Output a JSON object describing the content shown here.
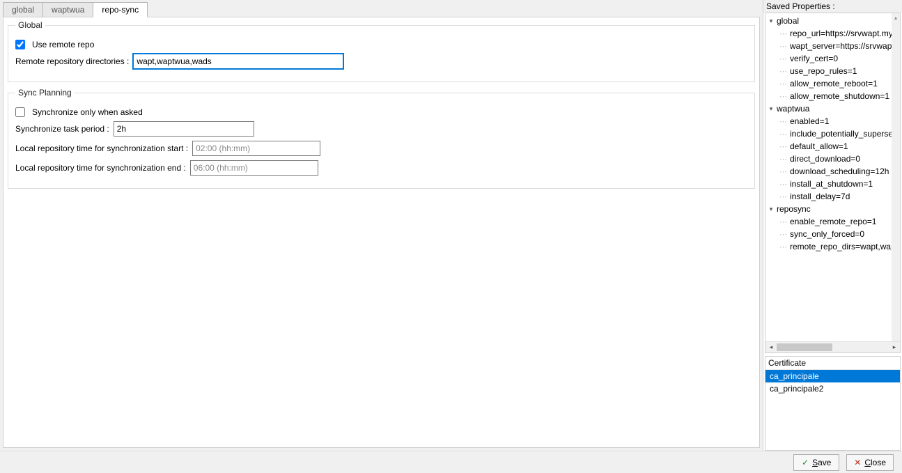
{
  "tabs": {
    "global": "global",
    "waptwua": "waptwua",
    "reposync": "repo-sync",
    "active": "reposync"
  },
  "global_group": {
    "legend": "Global",
    "use_remote_repo_label": "Use remote repo",
    "use_remote_repo_checked": true,
    "remote_dirs_label": "Remote repository directories :",
    "remote_dirs_value": "wapt,waptwua,wads"
  },
  "sync_group": {
    "legend": "Sync Planning",
    "sync_only_label": "Synchronize only when asked",
    "sync_only_checked": false,
    "period_label": "Synchronize task period :",
    "period_value": "2h",
    "start_label": "Local repository time for synchronization start :",
    "start_value": "02:00 (hh:mm)",
    "end_label": "Local repository time for synchronization end :",
    "end_value": "06:00 (hh:mm)"
  },
  "saved_props": {
    "title": "Saved Properties :",
    "nodes": [
      {
        "type": "root",
        "label": "global"
      },
      {
        "type": "child",
        "label": "repo_url=https://srvwapt.my"
      },
      {
        "type": "child",
        "label": "wapt_server=https://srvwapt"
      },
      {
        "type": "child",
        "label": "verify_cert=0"
      },
      {
        "type": "child",
        "label": "use_repo_rules=1"
      },
      {
        "type": "child",
        "label": "allow_remote_reboot=1"
      },
      {
        "type": "child",
        "label": "allow_remote_shutdown=1"
      },
      {
        "type": "root",
        "label": "waptwua"
      },
      {
        "type": "child",
        "label": "enabled=1"
      },
      {
        "type": "child",
        "label": "include_potentially_supersed"
      },
      {
        "type": "child",
        "label": "default_allow=1"
      },
      {
        "type": "child",
        "label": "direct_download=0"
      },
      {
        "type": "child",
        "label": "download_scheduling=12h"
      },
      {
        "type": "child",
        "label": "install_at_shutdown=1"
      },
      {
        "type": "child",
        "label": "install_delay=7d"
      },
      {
        "type": "root",
        "label": "reposync"
      },
      {
        "type": "child",
        "label": "enable_remote_repo=1"
      },
      {
        "type": "child",
        "label": "sync_only_forced=0"
      },
      {
        "type": "child",
        "label": "remote_repo_dirs=wapt,wap"
      }
    ]
  },
  "certificate": {
    "header": "Certificate",
    "items": [
      "ca_principale",
      "ca_principale2"
    ],
    "selected_index": 0
  },
  "footer": {
    "save": "Save",
    "close": "Close"
  }
}
